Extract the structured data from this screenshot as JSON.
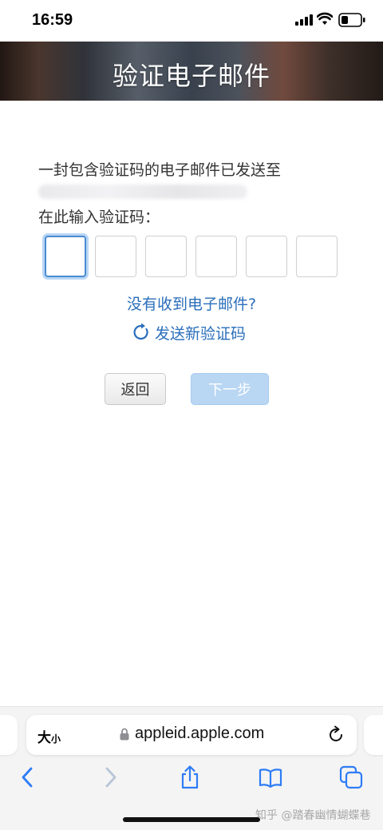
{
  "status_bar": {
    "time": "16:59"
  },
  "header": {
    "title": "验证电子邮件"
  },
  "form": {
    "intro": "一封包含验证码的电子邮件已发送至",
    "enter_label": "在此输入验证码：",
    "code_digits": [
      "",
      "",
      "",
      "",
      "",
      ""
    ],
    "no_email_link": "没有收到电子邮件?",
    "resend_link": "发送新验证码",
    "back_button": "返回",
    "next_button": "下一步"
  },
  "browser": {
    "text_size_large": "大",
    "text_size_small": "小",
    "url": "appleid.apple.com"
  },
  "watermark": "知乎 @踏春幽情蝴蝶巷",
  "colors": {
    "link": "#2a6ebb",
    "focus": "#4a8bd1",
    "next_disabled": "#b9d6f3"
  },
  "icons": [
    "signal-icon",
    "wifi-icon",
    "battery-icon",
    "refresh-icon",
    "lock-icon",
    "reload-icon",
    "back-arrow-icon",
    "forward-arrow-icon",
    "share-icon",
    "bookmarks-icon",
    "tabs-icon"
  ]
}
